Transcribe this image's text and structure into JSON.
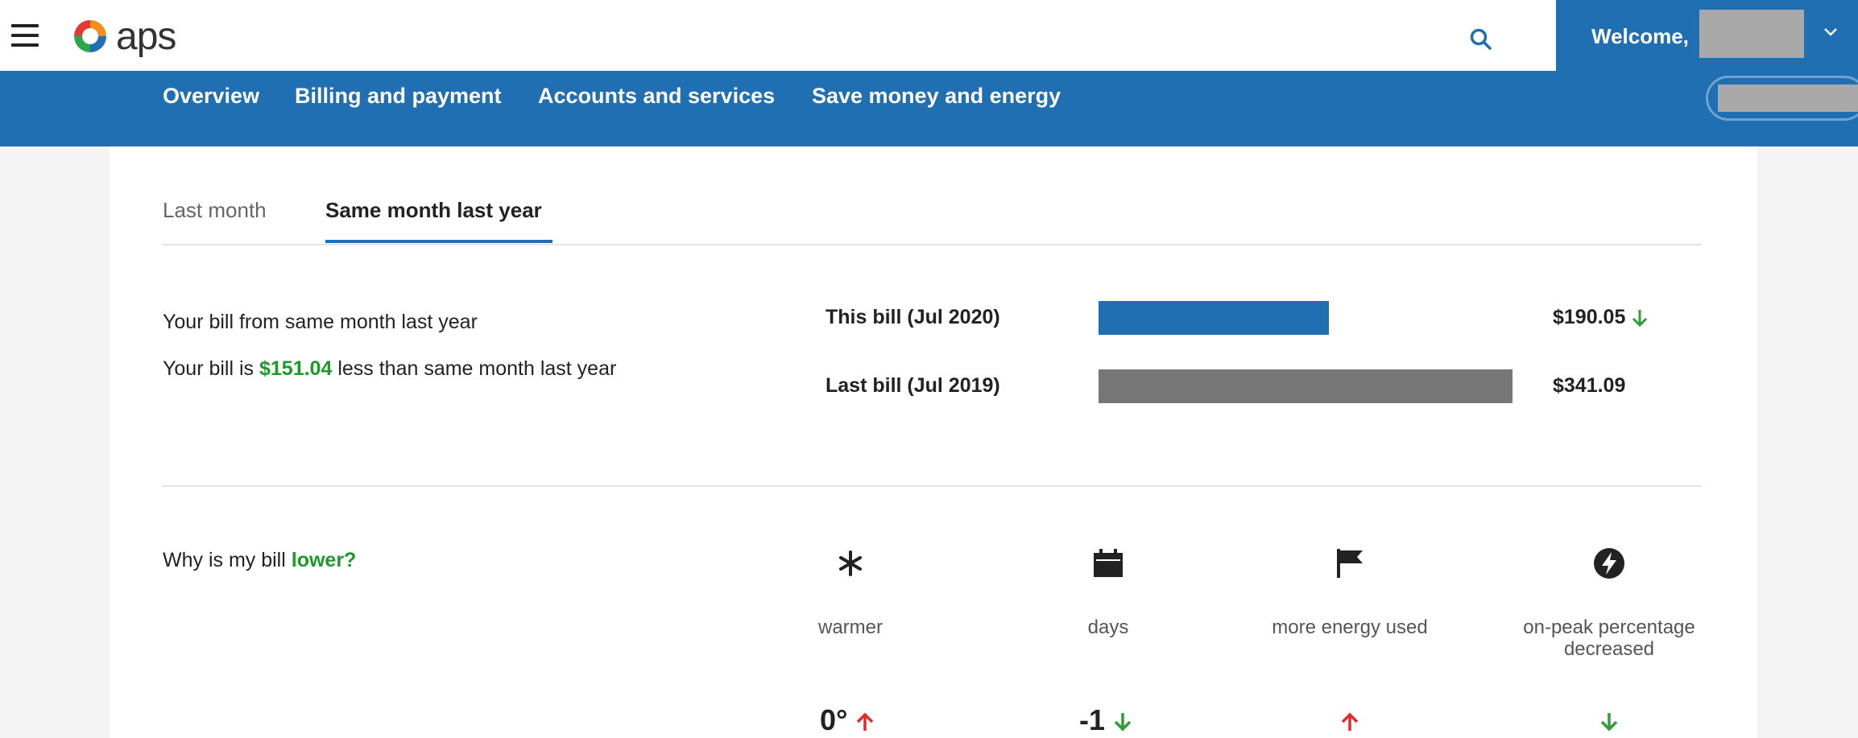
{
  "header": {
    "logo_text": "aps",
    "welcome_label": "Welcome,",
    "colors": {
      "brand_blue": "#1f6fb2",
      "redacted": "#a9a9a9"
    }
  },
  "nav": {
    "items": [
      {
        "label": "Overview"
      },
      {
        "label": "Billing and payment"
      },
      {
        "label": "Accounts and services"
      },
      {
        "label": "Save money and energy"
      }
    ]
  },
  "comparison": {
    "tabs": [
      {
        "label": "Last month",
        "active": false
      },
      {
        "label": "Same month last year",
        "active": true
      }
    ],
    "summary_line1": "Your bill from same month last year",
    "summary_prefix": "Your bill is",
    "summary_amount": "$151.04",
    "summary_suffix": "less than same month last year",
    "bills": [
      {
        "label": "This bill (Jul 2020)",
        "amount": "$190.05",
        "value": 190.05,
        "trend": "down",
        "color": "#1f6fb2"
      },
      {
        "label": "Last bill (Jul 2019)",
        "amount": "$341.09",
        "value": 341.09,
        "trend": "none",
        "color": "#777777"
      }
    ]
  },
  "why": {
    "question_prefix": "Why is my bill",
    "question_highlight": "lower?",
    "factors": [
      {
        "icon": "snowflake-icon",
        "label": "warmer",
        "value": "0°",
        "trend": "up"
      },
      {
        "icon": "calendar-icon",
        "label": "days",
        "value": "-1",
        "trend": "down"
      },
      {
        "icon": "flag-icon",
        "label": "more energy used",
        "value": "",
        "trend": "up"
      },
      {
        "icon": "lightning-icon",
        "label": "on-peak percentage decreased",
        "value": "",
        "trend": "down"
      }
    ]
  },
  "trend_colors": {
    "up": "#e02b2b",
    "down": "#2e9d3a"
  }
}
